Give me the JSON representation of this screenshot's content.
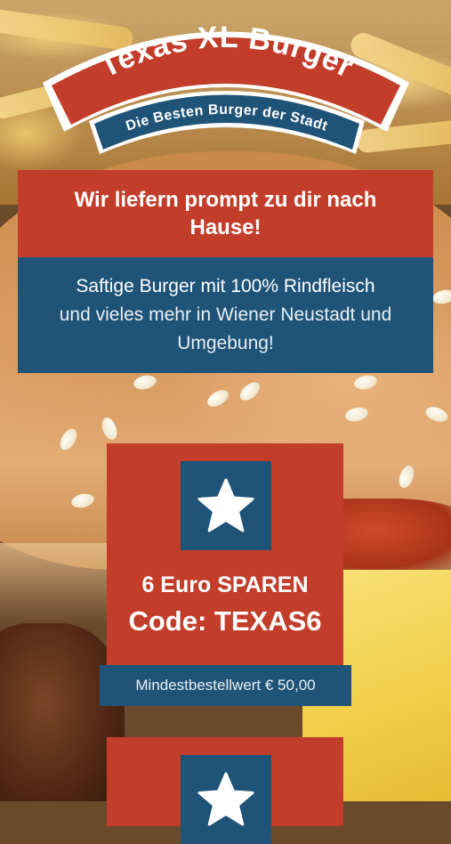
{
  "logo": {
    "title": "Texas XL Burger",
    "tagline": "Die Besten Burger der Stadt"
  },
  "headline": "Wir liefern prompt zu dir nach Hause!",
  "intro": {
    "line1": "Saftige Burger mit 100% Rindfleisch",
    "line2": "und vieles mehr in Wiener Neustadt und Umgebung!"
  },
  "coupons": [
    {
      "icon": "star-icon",
      "offer": "6 Euro SPAREN",
      "code": "Code: TEXAS6",
      "min_order": "Mindestbestellwert € 50,00"
    },
    {
      "icon": "star-icon"
    }
  ],
  "colors": {
    "brand_red": "#c23e2b",
    "brand_blue": "#1f5478",
    "text_white": "#ffffff"
  }
}
